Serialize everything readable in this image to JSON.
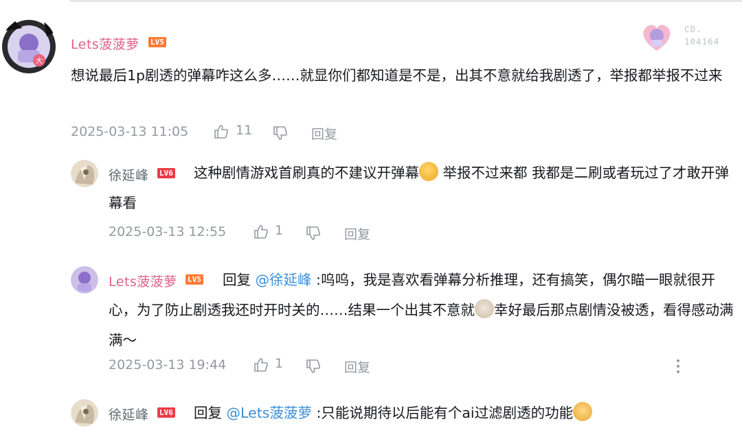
{
  "comment_main": {
    "username": "Lets菠菠萝",
    "level": "LV5",
    "content": "想说最后1p剧透的弹幕咋这么多……就显你们都知道是不是，出其不意就给我剧透了，举报都举报不过来",
    "timestamp": "2025-03-13 11:05",
    "like_count": "11",
    "reply_label": "回复",
    "badge_text": "CD.\n104164"
  },
  "replies": [
    {
      "username": "徐延峰",
      "level": "LV6",
      "content_a": "这种剧情游戏首刷真的不建议开弹幕",
      "content_b": " 举报不过来都 我都是二刷或者玩过了才敢开弹幕看",
      "timestamp": "2025-03-13 12:55",
      "like_count": "1",
      "reply_label": "回复"
    },
    {
      "username": "Lets菠菠萝",
      "level": "LV5",
      "reply_prefix": "回复 ",
      "mention": "@徐延峰",
      "content_a": " :呜呜，我是喜欢看弹幕分析推理，还有搞笑，偶尔瞄一眼就很开心，为了防止剧透我还时开时关的……结果一个出其不意就",
      "content_b": "幸好最后那点剧情没被透，看得感动满满～",
      "timestamp": "2025-03-13 19:44",
      "like_count": "1",
      "reply_label": "回复"
    },
    {
      "username": "徐延峰",
      "level": "LV6",
      "reply_prefix": "回复 ",
      "mention": "@Lets菠菠萝",
      "content_a": " :只能说期待以后能有个ai过滤剧透的功能"
    }
  ],
  "colors": {
    "name_pink": "#e0608d",
    "mention_blue": "#3b8fd7",
    "meta_gray": "#9499a0",
    "lv5": "#ff7a33",
    "lv6": "#ee3a45"
  }
}
